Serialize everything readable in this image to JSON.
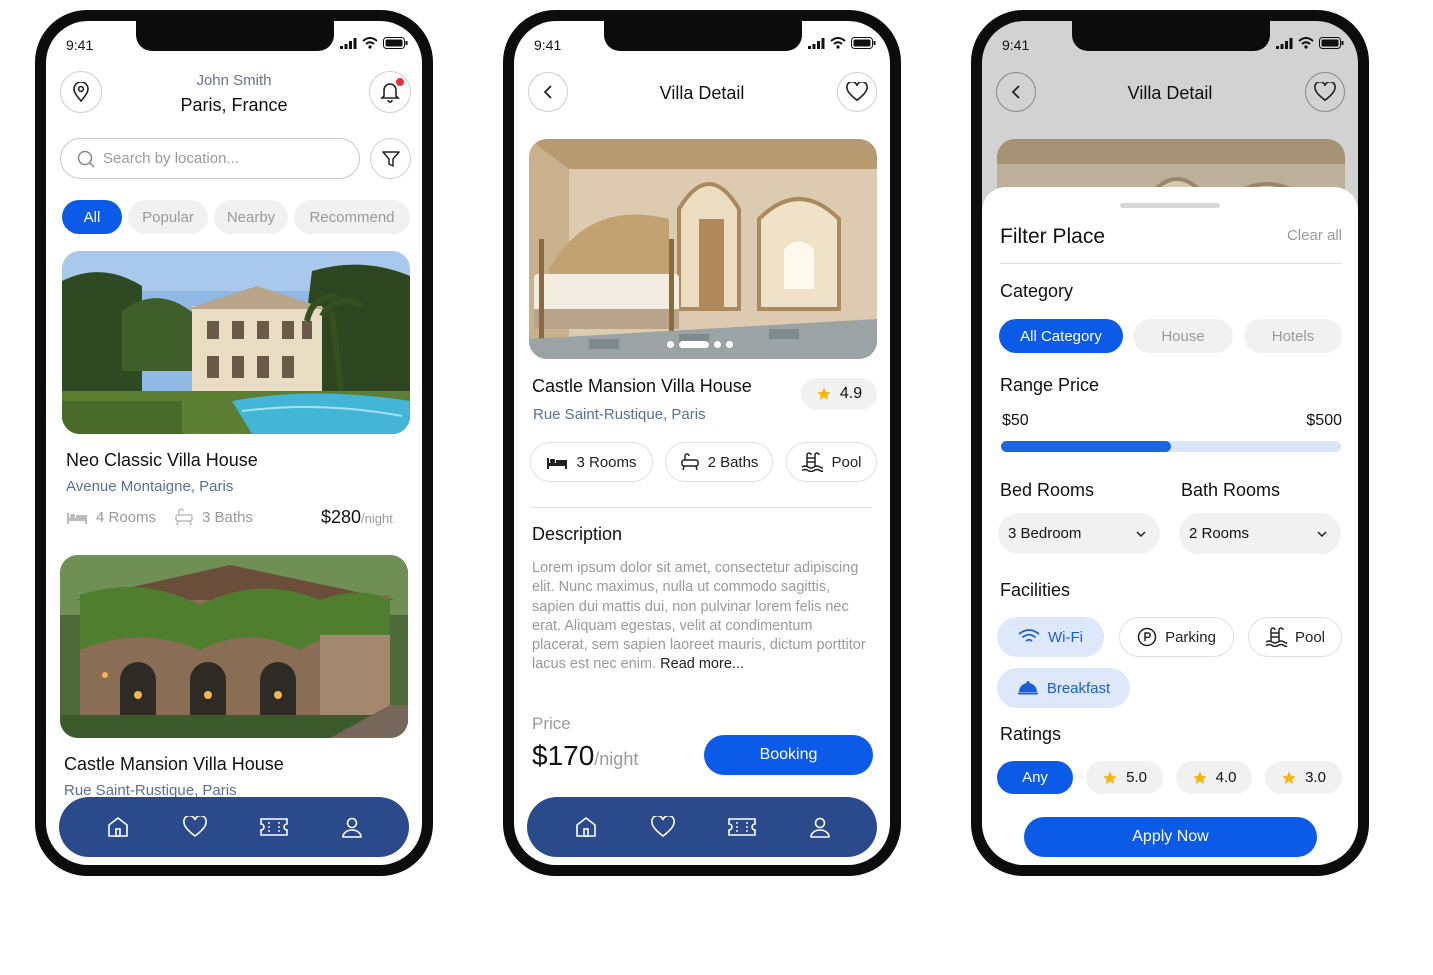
{
  "status_time": "9:41",
  "home": {
    "user_name": "John Smith",
    "location": "Paris, France",
    "search_placeholder": "Search by location...",
    "tabs": [
      "All",
      "Popular",
      "Nearby",
      "Recommend"
    ],
    "cards": [
      {
        "title": "Neo Classic Villa House",
        "address": "Avenue Montaigne, Paris",
        "rooms": "4 Rooms",
        "baths": "3 Baths",
        "price": "$280",
        "per": "/night"
      },
      {
        "title": "Castle Mansion Villa House",
        "address": "Rue Saint-Rustique, Paris"
      }
    ]
  },
  "detail": {
    "header": "Villa Detail",
    "title": "Castle Mansion Villa House",
    "rating": "4.9",
    "address": "Rue Saint-Rustique, Paris",
    "features": [
      "3 Rooms",
      "2 Baths",
      "Pool"
    ],
    "description_title": "Description",
    "description": "Lorem ipsum dolor sit amet, consectetur adipiscing elit. Nunc maximus, nulla ut commodo sagittis, sapien dui mattis dui, non pulvinar lorem felis nec erat. Aliquam egestas, velit at condimentum placerat, sem sapien laoreet mauris, dictum porttitor lacus est nec enim.",
    "read_more": "Read more...",
    "price_label": "Price",
    "price": "$170",
    "per": "/night",
    "booking": "Booking"
  },
  "filter": {
    "header": "Villa Detail",
    "title": "Filter Place",
    "clear": "Clear all",
    "category_label": "Category",
    "categories": [
      "All Category",
      "House",
      "Hotels"
    ],
    "range_label": "Range Price",
    "range_min": "$50",
    "range_max": "$500",
    "range_fill_fraction": 0.5,
    "bed_label": "Bed Rooms",
    "bath_label": "Bath Rooms",
    "bed_value": "3 Bedroom",
    "bath_value": "2 Rooms",
    "facilities_label": "Facilities",
    "facilities": [
      "Wi-Fi",
      "Parking",
      "Pool",
      "Breakfast"
    ],
    "ratings_label": "Ratings",
    "ratings": [
      "Any",
      "5.0",
      "4.0",
      "3.0"
    ],
    "apply": "Apply Now"
  },
  "colors": {
    "primary": "#0c5ae8",
    "nav": "#2b4a8b",
    "star": "#f5b50a",
    "link": "#5b6f9c"
  }
}
